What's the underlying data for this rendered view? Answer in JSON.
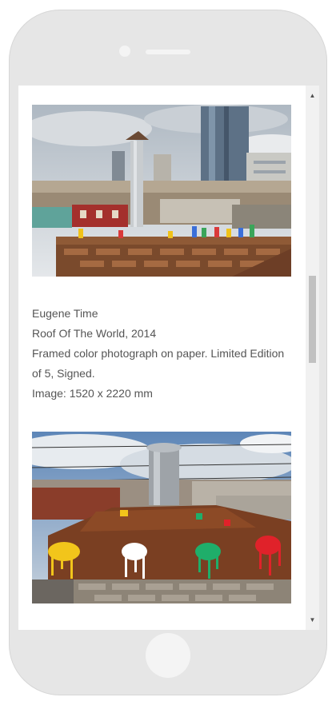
{
  "artwork": {
    "artist": "Eugene Time",
    "title": "Roof Of The World, 2014",
    "description_line1": "Framed color photograph on paper. Limited Edition",
    "description_line2": "of 5, Signed.",
    "dimensions": "Image: 1520 x 2220 mm"
  },
  "scrollbar": {
    "up_arrow": "▲",
    "down_arrow": "▼",
    "position_fraction": 0.41
  },
  "colors": {
    "device_body": "#e6e6e6",
    "caption_text": "#555555",
    "scroll_thumb": "#c1c1c1"
  }
}
